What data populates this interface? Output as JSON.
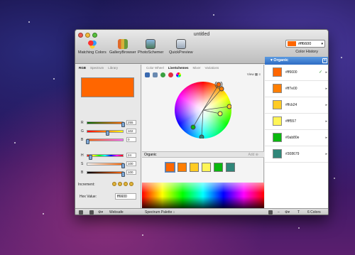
{
  "window": {
    "title": "untitled"
  },
  "toolbar": {
    "items": [
      {
        "label": "Matching Colors",
        "color": "#d84030"
      },
      {
        "label": "GalleryBrowser",
        "color": "#c8902a"
      },
      {
        "label": "PhotoSchemer",
        "color": "#5a8ab4"
      },
      {
        "label": "QuickPreview",
        "color": "#7a8a9a"
      }
    ]
  },
  "color_history": {
    "value": "#ff6600",
    "label": "Color History"
  },
  "left_tabs": [
    "RGB",
    "Spectrum",
    "Library"
  ],
  "mid_tabs": [
    "Color Wheel",
    "LiveSchemes",
    "Mixer",
    "Variations"
  ],
  "mid_view_label": "View",
  "current_color": "#ff6600",
  "sliders": [
    {
      "label": "R",
      "value": "255",
      "grad": "linear-gradient(90deg,#006600,#ff6600)",
      "pos": 0.98
    },
    {
      "label": "G",
      "value": "102",
      "grad": "linear-gradient(90deg,#ff0000,#ffff00)",
      "pos": 0.55
    },
    {
      "label": "B",
      "value": "0",
      "grad": "linear-gradient(90deg,#ff6600,#ff66ff)",
      "pos": 0.0
    },
    {
      "label": "H",
      "value": "24",
      "grad": "linear-gradient(90deg,#ff0000,#ffff00,#00ff00,#00ffff,#0000ff,#ff00ff,#ff0000)",
      "pos": 0.08
    },
    {
      "label": "S",
      "value": "100",
      "grad": "linear-gradient(90deg,#ffffff,#ff6600)",
      "pos": 0.98
    },
    {
      "label": "B",
      "value": "100",
      "grad": "linear-gradient(90deg,#000000,#ff6600)",
      "pos": 0.98
    }
  ],
  "increment": {
    "label": "Increment:"
  },
  "hex": {
    "label": "Hex Value:",
    "value": "ff6600"
  },
  "scheme": {
    "name": "Organic",
    "add_label": "Add"
  },
  "scheme_swatches": [
    "#ff6600",
    "#ff7e00",
    "#ffcb24",
    "#fff557",
    "#0ab80e",
    "#308679"
  ],
  "palette": {
    "header": "Organic",
    "items": [
      {
        "hex": "#ff6600",
        "color": "#ff6600",
        "selected": true
      },
      {
        "hex": "#ff7e00",
        "color": "#ff7e00",
        "selected": false
      },
      {
        "hex": "#ffcb24",
        "color": "#ffcb24",
        "selected": false
      },
      {
        "hex": "#fff557",
        "color": "#fff557",
        "selected": false
      },
      {
        "hex": "#0ab80e",
        "color": "#0ab80e",
        "selected": false
      },
      {
        "hex": "#308679",
        "color": "#308679",
        "selected": false
      }
    ]
  },
  "bottom": {
    "websafe": "Websafe",
    "spectrum": "Spectrum Palette",
    "count": "6 Colors"
  }
}
